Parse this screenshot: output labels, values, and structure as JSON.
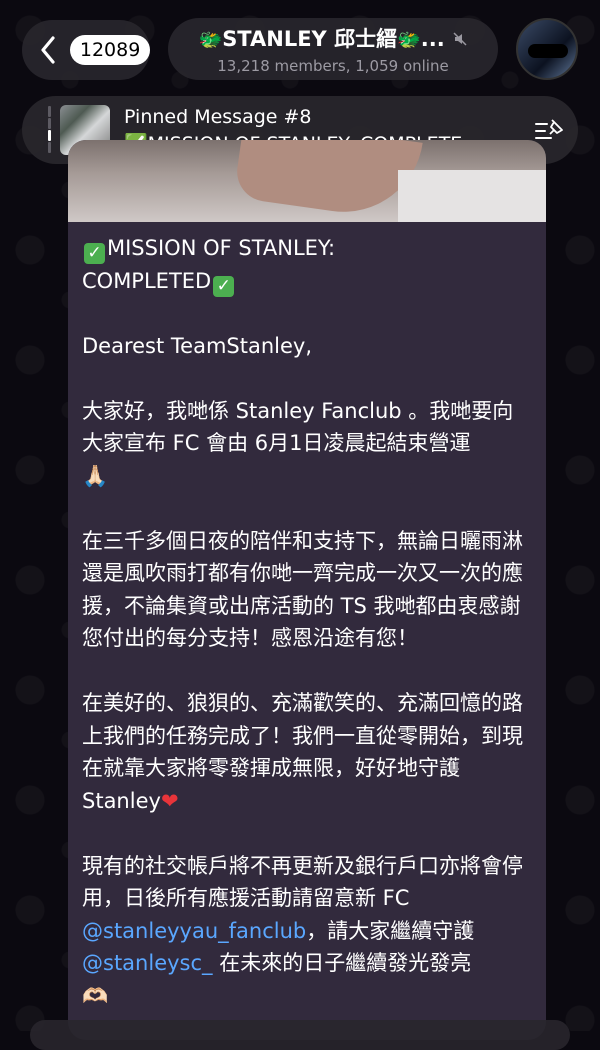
{
  "header": {
    "back_count": "12089",
    "title": "STANLEY 邱士縉",
    "title_ellipsis": "...",
    "title_emoji": "🐲",
    "subtitle": "13,218 members, 1,059 online"
  },
  "pinned": {
    "title": "Pinned Message #8",
    "text": "✅MISSION OF STANLEY: COMPLETE..."
  },
  "message": {
    "heading_1": "MISSION OF STANLEY:",
    "heading_2": "COMPLETED",
    "greeting": "Dearest TeamStanley,",
    "para1": "大家好，我哋係 Stanley Fanclub 。我哋要向大家宣布 FC 會由 6月1日凌晨起結束營運",
    "para1_emoji": "🙏🏻",
    "para2": "在三千多個日夜的陪伴和支持下，無論日曬雨淋還是風吹雨打都有你哋一齊完成一次又一次的應援，不論集資或出席活動的 TS 我哋都由衷感謝您付出的每分支持！感恩沿途有您！",
    "para3": "在美好的、狼狽的、充滿歡笑的、充滿回憶的路上我們的任務完成了！我們一直從零開始，到現在就靠大家將零發揮成無限，好好地守護 Stanley",
    "para3_emoji": "❤",
    "para4_a": "現有的社交帳戶將不再更新及銀行戶口亦將會停用，日後所有應援活動請留意新 FC ",
    "link1": "@stanleyyau_fanclub",
    "para4_b": "，請大家繼續守護 ",
    "link2": "@stanleysc_",
    "para4_c": " 在未來的日子繼續發光發亮",
    "para4_emoji": "🫶🏻"
  },
  "colors": {
    "bubble": "#322a3d",
    "link": "#5aa7ff",
    "check": "#4caf50",
    "heart": "#e8343a"
  },
  "icons": [
    "back-chevron-icon",
    "mute-icon",
    "pin-list-icon",
    "check-mark-emoji",
    "dragon-emoji",
    "praying-hands-emoji",
    "heart-emoji",
    "heart-hands-emoji"
  ]
}
